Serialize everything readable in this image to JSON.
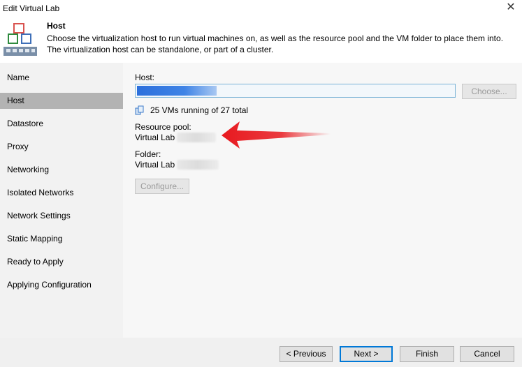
{
  "window": {
    "title": "Edit Virtual Lab",
    "close_glyph": "✕"
  },
  "header": {
    "title": "Host",
    "description": "Choose the virtualization host to run virtual machines on, as well as the resource pool and the VM folder to place them into. The virtualization host can be standalone, or part of a cluster."
  },
  "sidebar": {
    "items": [
      {
        "label": "Name",
        "active": false
      },
      {
        "label": "Host",
        "active": true
      },
      {
        "label": "Datastore",
        "active": false
      },
      {
        "label": "Proxy",
        "active": false
      },
      {
        "label": "Networking",
        "active": false
      },
      {
        "label": "Isolated Networks",
        "active": false
      },
      {
        "label": "Network Settings",
        "active": false
      },
      {
        "label": "Static Mapping",
        "active": false
      },
      {
        "label": "Ready to Apply",
        "active": false
      },
      {
        "label": "Applying Configuration",
        "active": false
      }
    ]
  },
  "main": {
    "host_label": "Host:",
    "host_value": "",
    "choose_button": "Choose...",
    "vm_status": "25 VMs running of 27 total",
    "resource_pool_label": "Resource pool:",
    "resource_pool_value": "Virtual Lab",
    "folder_label": "Folder:",
    "folder_value": "Virtual Lab",
    "configure_button": "Configure..."
  },
  "footer": {
    "previous": "< Previous",
    "next": "Next >",
    "finish": "Finish",
    "cancel": "Cancel"
  },
  "colors": {
    "accent": "#0078d7",
    "active_nav": "#b3b3b3",
    "arrow": "#e8191f"
  },
  "icons": {
    "header": "virtual-lab-icon",
    "vm_status": "vm-host-icon",
    "annotation": "red-arrow-icon"
  }
}
